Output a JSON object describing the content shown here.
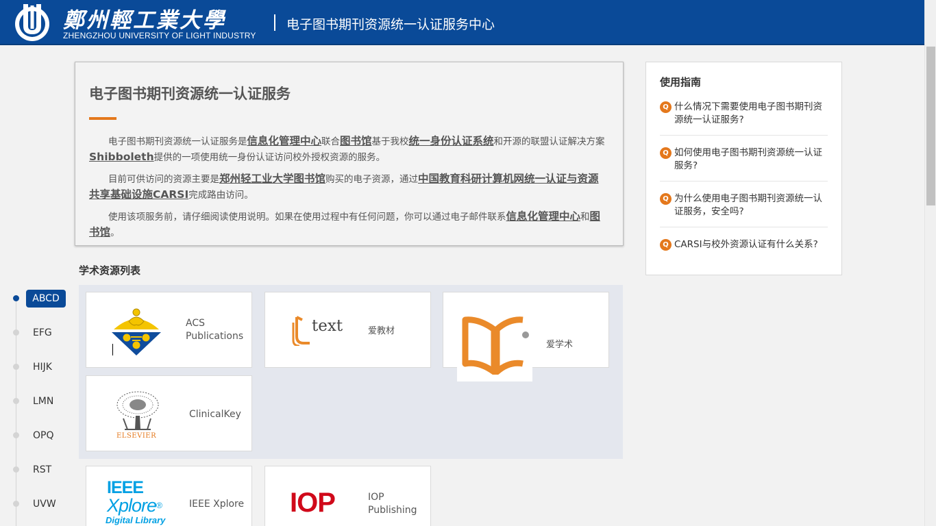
{
  "header": {
    "logo_cn": "鄭州輕工業大學",
    "logo_en": "ZHENGZHOU UNIVERSITY OF LIGHT INDUSTRY",
    "title": "电子图书期刊资源统一认证服务中心"
  },
  "intro": {
    "title": "电子图书期刊资源统一认证服务",
    "p1": [
      "电子图书期刊资源统一认证服务是",
      "信息化管理中心",
      "联合",
      "图书馆",
      "基于我校",
      "统一身份认证系统",
      "和开源的联盟认证解决方案",
      "Shibboleth",
      "提供的一项使用统一身份认证访问校外授权资源的服务。"
    ],
    "p2": [
      "目前可供访问的资源主要是",
      "郑州轻工业大学图书馆",
      "购买的电子资源，通过",
      "中国教育科研计算机网统一认证与资源共享基础设施CARSI",
      "完成路由访问。"
    ],
    "p3": [
      "使用该项服务前，请仔细阅读使用说明。如果在使用过程中有任何问题，你可以通过电子邮件联系",
      "信息化管理中心",
      "和",
      "图书馆",
      "。"
    ]
  },
  "guide": {
    "title": "使用指南",
    "q_badge": "Q",
    "items": [
      "什么情况下需要使用电子图书期刊资源统一认证服务?",
      "如何使用电子图书期刊资源统一认证服务?",
      "为什么使用电子图书期刊资源统一认证服务，安全吗?",
      "CARSI与校外资源认证有什么关系?"
    ]
  },
  "resources": {
    "section_title": "学术资源列表",
    "alpha": [
      "ABCD",
      "EFG",
      "HIJK",
      "LMN",
      "OPQ",
      "RST",
      "UVW"
    ],
    "active_alpha": "ABCD",
    "group_abcd": [
      {
        "name": "ACS Publications",
        "line1": "ACS",
        "line2": "Publications",
        "logo_text": "ACS"
      },
      {
        "name": "爱教材",
        "logo_text": "text"
      },
      {
        "name": "爱学术"
      },
      {
        "name": "ClinicalKey",
        "logo_text": "ELSEVIER"
      }
    ],
    "group_next": [
      {
        "name": "IEEE Xplore",
        "logo_line1": "IEEE",
        "logo_line2": "Xplore",
        "logo_mark": "®",
        "logo_line3": "Digital Library"
      },
      {
        "name": "IOP Publishing",
        "line1": "IOP",
        "line2": "Publishing",
        "logo_text": "IOP"
      }
    ]
  },
  "colors": {
    "header_bg": "#0a4a98",
    "accent": "#e4781c",
    "ieee_blue": "#00a0e3",
    "iop_red": "#d0091a"
  }
}
